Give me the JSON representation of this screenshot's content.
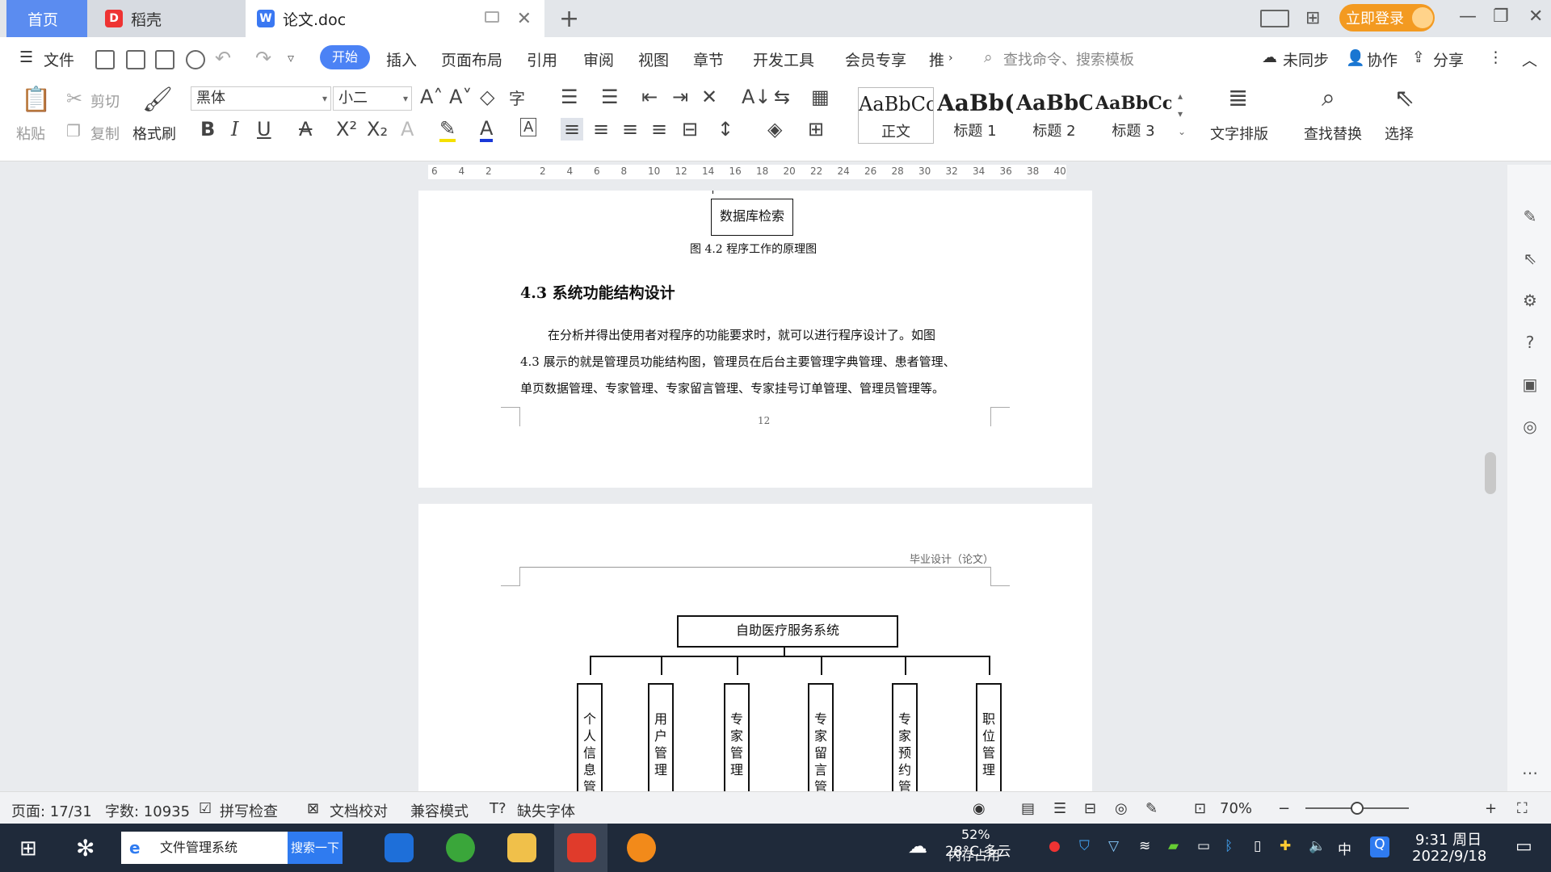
{
  "tabs": {
    "home": "首页",
    "daoke": "稻壳",
    "doc": "论文.doc"
  },
  "titlebar": {
    "login": "立即登录"
  },
  "menu": {
    "file": "文件",
    "items": [
      "开始",
      "插入",
      "页面布局",
      "引用",
      "审阅",
      "视图",
      "章节",
      "开发工具",
      "会员专享",
      "推"
    ],
    "search_placeholder": "查找命令、搜索模板",
    "unsynced": "未同步",
    "collab": "协作",
    "share": "分享"
  },
  "ribbon": {
    "paste": "粘贴",
    "cut": "剪切",
    "copy": "复制",
    "format_painter": "格式刷",
    "font": "黑体",
    "size": "小二",
    "styles": [
      {
        "preview": "AaBbCcI",
        "label": "正文"
      },
      {
        "preview": "AaBb(",
        "label": "标题 1"
      },
      {
        "preview": "AaBbC",
        "label": "标题 2"
      },
      {
        "preview": "AaBbCcI",
        "label": "标题 3"
      }
    ],
    "text_layout": "文字排版",
    "find_replace": "查找替换",
    "select": "选择"
  },
  "ruler": [
    "6",
    "4",
    "2",
    "",
    "2",
    "4",
    "6",
    "8",
    "10",
    "12",
    "14",
    "16",
    "18",
    "20",
    "22",
    "24",
    "26",
    "28",
    "30",
    "32",
    "34",
    "36",
    "38",
    "40"
  ],
  "page1": {
    "box_label": "数据库检索",
    "figure_caption": "图 4.2  程序工作的原理图",
    "heading": "4.3  系统功能结构设计",
    "para_line1": "在分析并得出使用者对程序的功能要求时，就可以进行程序设计了。如图",
    "para_line2": "4.3 展示的就是管理员功能结构图，管理员在后台主要管理字典管理、患者管理、",
    "para_line3": "单页数据管理、专家管理、专家留言管理、专家挂号订单管理、管理员管理等。",
    "page_number": "12"
  },
  "page2": {
    "header_text": "毕业设计（论文）",
    "root": "自助医疗服务系统",
    "children": [
      "个人信息管",
      "用户管理",
      "专家管理",
      "专家留言管",
      "专家预约管",
      "职位管理"
    ]
  },
  "status": {
    "page": "页面: 17/31",
    "words": "字数: 10935",
    "spell": "拼写检查",
    "proof": "文档校对",
    "compat": "兼容模式",
    "missing_font": "缺失字体",
    "zoom": "70%",
    "zoom_fraction": 0.5
  },
  "taskbar": {
    "search_text": "文件管理系统",
    "search_btn": "搜索一下",
    "weather": "28°C 多云",
    "memory": "52%",
    "memory_label": "内存占用",
    "ime": "中",
    "time": "9:31 周日",
    "date": "2022/9/18"
  }
}
